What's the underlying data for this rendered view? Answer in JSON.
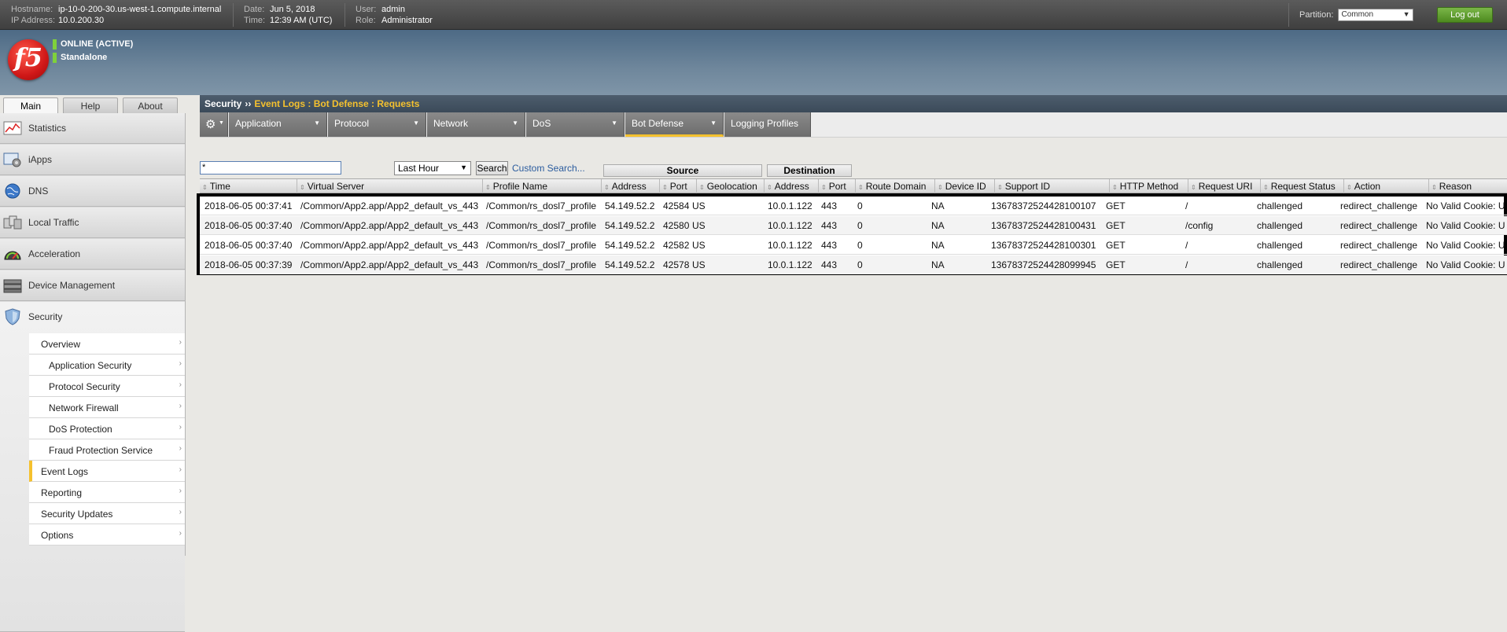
{
  "topbar": {
    "hostname_label": "Hostname:",
    "hostname": "ip-10-0-200-30.us-west-1.compute.internal",
    "ip_label": "IP Address:",
    "ip": "10.0.200.30",
    "date_label": "Date:",
    "date": "Jun 5, 2018",
    "time_label": "Time:",
    "time": "12:39 AM (UTC)",
    "user_label": "User:",
    "user": "admin",
    "role_label": "Role:",
    "role": "Administrator",
    "partition_label": "Partition:",
    "partition_value": "Common",
    "logout_label": "Log out"
  },
  "status": {
    "line1": "ONLINE (ACTIVE)",
    "line2": "Standalone"
  },
  "logo": {
    "text": "f5"
  },
  "main_tabs": [
    {
      "label": "Main"
    },
    {
      "label": "Help"
    },
    {
      "label": "About"
    }
  ],
  "sidebar": {
    "items": [
      {
        "label": "Statistics"
      },
      {
        "label": "iApps"
      },
      {
        "label": "DNS"
      },
      {
        "label": "Local Traffic"
      },
      {
        "label": "Acceleration"
      },
      {
        "label": "Device Management"
      },
      {
        "label": "Security"
      }
    ],
    "security_sub": [
      {
        "label": "Overview"
      },
      {
        "label": "Application Security"
      },
      {
        "label": "Protocol Security"
      },
      {
        "label": "Network Firewall"
      },
      {
        "label": "DoS Protection"
      },
      {
        "label": "Fraud Protection Service"
      },
      {
        "label": "Event Logs"
      },
      {
        "label": "Reporting"
      },
      {
        "label": "Security Updates"
      },
      {
        "label": "Options"
      }
    ]
  },
  "breadcrumb": {
    "root": "Security",
    "arrow": "››",
    "path": "Event Logs : Bot Defense : Requests"
  },
  "menubar": {
    "items": [
      {
        "label": "Application"
      },
      {
        "label": "Protocol"
      },
      {
        "label": "Network"
      },
      {
        "label": "DoS"
      },
      {
        "label": "Bot Defense"
      },
      {
        "label": "Logging Profiles"
      }
    ]
  },
  "filter": {
    "search_value": "*",
    "range_value": "Last Hour",
    "search_button": "Search",
    "custom_search": "Custom Search..."
  },
  "groups": {
    "source": "Source",
    "destination": "Destination"
  },
  "table": {
    "headers": [
      "Time",
      "Virtual Server",
      "Profile Name",
      "Address",
      "Port",
      "Geolocation",
      "Address",
      "Port",
      "Route Domain",
      "Device ID",
      "Support ID",
      "HTTP Method",
      "Request URI",
      "Request Status",
      "Action",
      "Reason"
    ],
    "rows": [
      [
        "2018-06-05 00:37:41",
        "/Common/App2.app/App2_default_vs_443",
        "/Common/rs_dosl7_profile",
        "54.149.52.2",
        "42584",
        "US",
        "10.0.1.122",
        "443",
        "0",
        "NA",
        "13678372524428100107",
        "GET",
        "/",
        "challenged",
        "redirect_challenge",
        "No Valid Cookie: U"
      ],
      [
        "2018-06-05 00:37:40",
        "/Common/App2.app/App2_default_vs_443",
        "/Common/rs_dosl7_profile",
        "54.149.52.2",
        "42580",
        "US",
        "10.0.1.122",
        "443",
        "0",
        "NA",
        "13678372524428100431",
        "GET",
        "/config",
        "challenged",
        "redirect_challenge",
        "No Valid Cookie: U"
      ],
      [
        "2018-06-05 00:37:40",
        "/Common/App2.app/App2_default_vs_443",
        "/Common/rs_dosl7_profile",
        "54.149.52.2",
        "42582",
        "US",
        "10.0.1.122",
        "443",
        "0",
        "NA",
        "13678372524428100301",
        "GET",
        "/",
        "challenged",
        "redirect_challenge",
        "No Valid Cookie: U"
      ],
      [
        "2018-06-05 00:37:39",
        "/Common/App2.app/App2_default_vs_443",
        "/Common/rs_dosl7_profile",
        "54.149.52.2",
        "42578",
        "US",
        "10.0.1.122",
        "443",
        "0",
        "NA",
        "13678372524428099945",
        "GET",
        "/",
        "challenged",
        "redirect_challenge",
        "No Valid Cookie: U"
      ]
    ]
  },
  "colors": {
    "accent": "#f5c12e",
    "status_green": "#7fd13b",
    "logout_green": "#5a9a2a",
    "link_blue": "#2b5c9e"
  }
}
